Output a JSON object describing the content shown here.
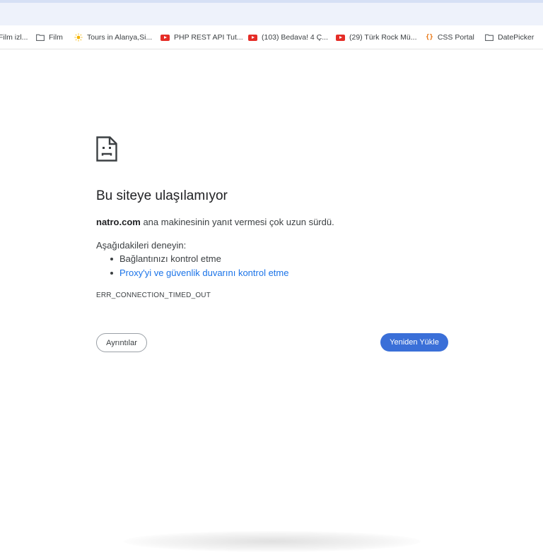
{
  "bookmarks": [
    {
      "label": "Film izl...",
      "icon": "none"
    },
    {
      "label": "Film",
      "icon": "folder-icon"
    },
    {
      "label": "Tours in Alanya,Si...",
      "icon": "sun-favicon-icon"
    },
    {
      "label": "PHP REST API Tut...",
      "icon": "youtube-icon"
    },
    {
      "label": "(103) Bedava! 4 Ç...",
      "icon": "youtube-icon"
    },
    {
      "label": "(29) Türk Rock Mü...",
      "icon": "youtube-icon"
    },
    {
      "label": "CSS Portal",
      "icon": "css-portal-icon",
      "icon_text": "{}"
    },
    {
      "label": "DatePicker",
      "icon": "folder-icon"
    }
  ],
  "error": {
    "icon": "sad-document-icon",
    "title": "Bu siteye ulaşılamıyor",
    "host": "natro.com",
    "description": " ana makinesinin yanıt vermesi çok uzun sürdü.",
    "try_label": "Aşağıdakileri deneyin:",
    "suggestions": [
      "Bağlantınızı kontrol etme",
      "Proxy'yi ve güvenlik duvarını kontrol etme"
    ],
    "code": "ERR_CONNECTION_TIMED_OUT"
  },
  "buttons": {
    "details": "Ayrıntılar",
    "reload": "Yeniden Yükle"
  },
  "colors": {
    "reload_button": "#3a6fd8",
    "link": "#1a73e8",
    "text": "#202124",
    "youtube": "#e52d27"
  }
}
